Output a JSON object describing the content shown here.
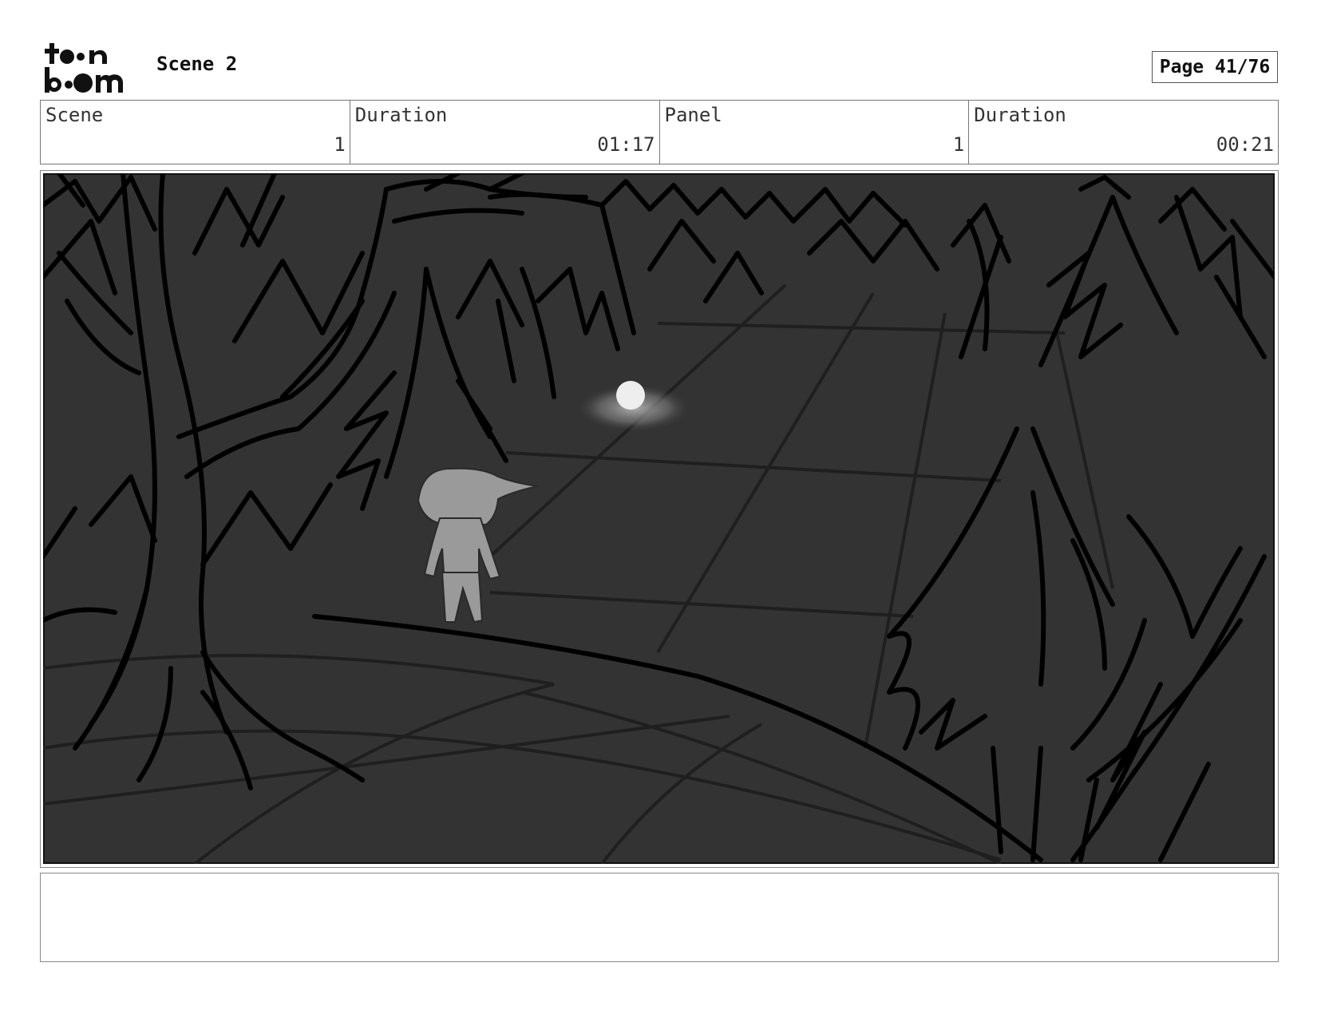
{
  "header": {
    "scene_title": "Scene 2",
    "page": "Page 41/76"
  },
  "info": {
    "scene_label": "Scene",
    "scene_value": "1",
    "duration_label": "Duration",
    "duration_value": "01:17",
    "panel_label": "Panel",
    "panel_value": "1",
    "panel_duration_label": "Duration",
    "panel_duration_value": "00:21"
  },
  "panel": {
    "background_color": "#333333",
    "line_color": "#000000",
    "figure_color": "#9a9a9a"
  },
  "notes": {
    "text": ""
  }
}
